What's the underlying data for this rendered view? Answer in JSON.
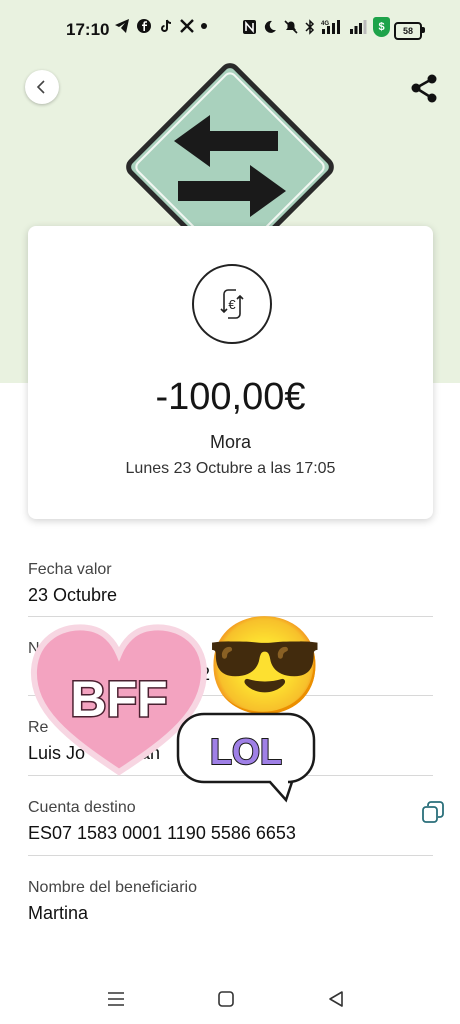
{
  "status_bar": {
    "time": "17:10",
    "left_icons": [
      "telegram-icon",
      "facebook-icon",
      "tiktok-icon",
      "x-icon",
      "dot-icon"
    ],
    "right_icons": [
      "nfc-icon",
      "moon-icon",
      "mute-icon",
      "bluetooth-icon",
      "signal-icon",
      "signal-icon",
      "shield-icon"
    ],
    "network": "4G",
    "battery": "58"
  },
  "header": {
    "back_icon": "chevron-left-icon",
    "share_icon": "share-icon",
    "image": "two-way-arrows-road-sign"
  },
  "transaction": {
    "icon": "euro-exchange-icon",
    "amount": "-100,00€",
    "concept": "Mora",
    "datetime": "Lunes 23 Octubre a las 17:05"
  },
  "details": [
    {
      "label": "Fecha valor",
      "value": "23 Octubre"
    },
    {
      "label": "N",
      "value": "2"
    },
    {
      "label": "Re",
      "value": "Luis Jo        man"
    },
    {
      "label": "Cuenta destino",
      "value": "ES07 1583 0001 1190 5586 6653"
    },
    {
      "label": "Nombre del beneficiario",
      "value": "Martina"
    }
  ],
  "stickers": {
    "heart_text": "BFF",
    "bubble_text": "LOL",
    "emoji": "😎"
  },
  "colors": {
    "hero_bg": "#e9f2e0",
    "sign_green": "#a9d1bd",
    "copy_icon": "#2a6f7a"
  },
  "navbar": {
    "menu_icon": "menu-icon",
    "home_icon": "square-home-icon",
    "back_icon": "triangle-back-icon"
  }
}
